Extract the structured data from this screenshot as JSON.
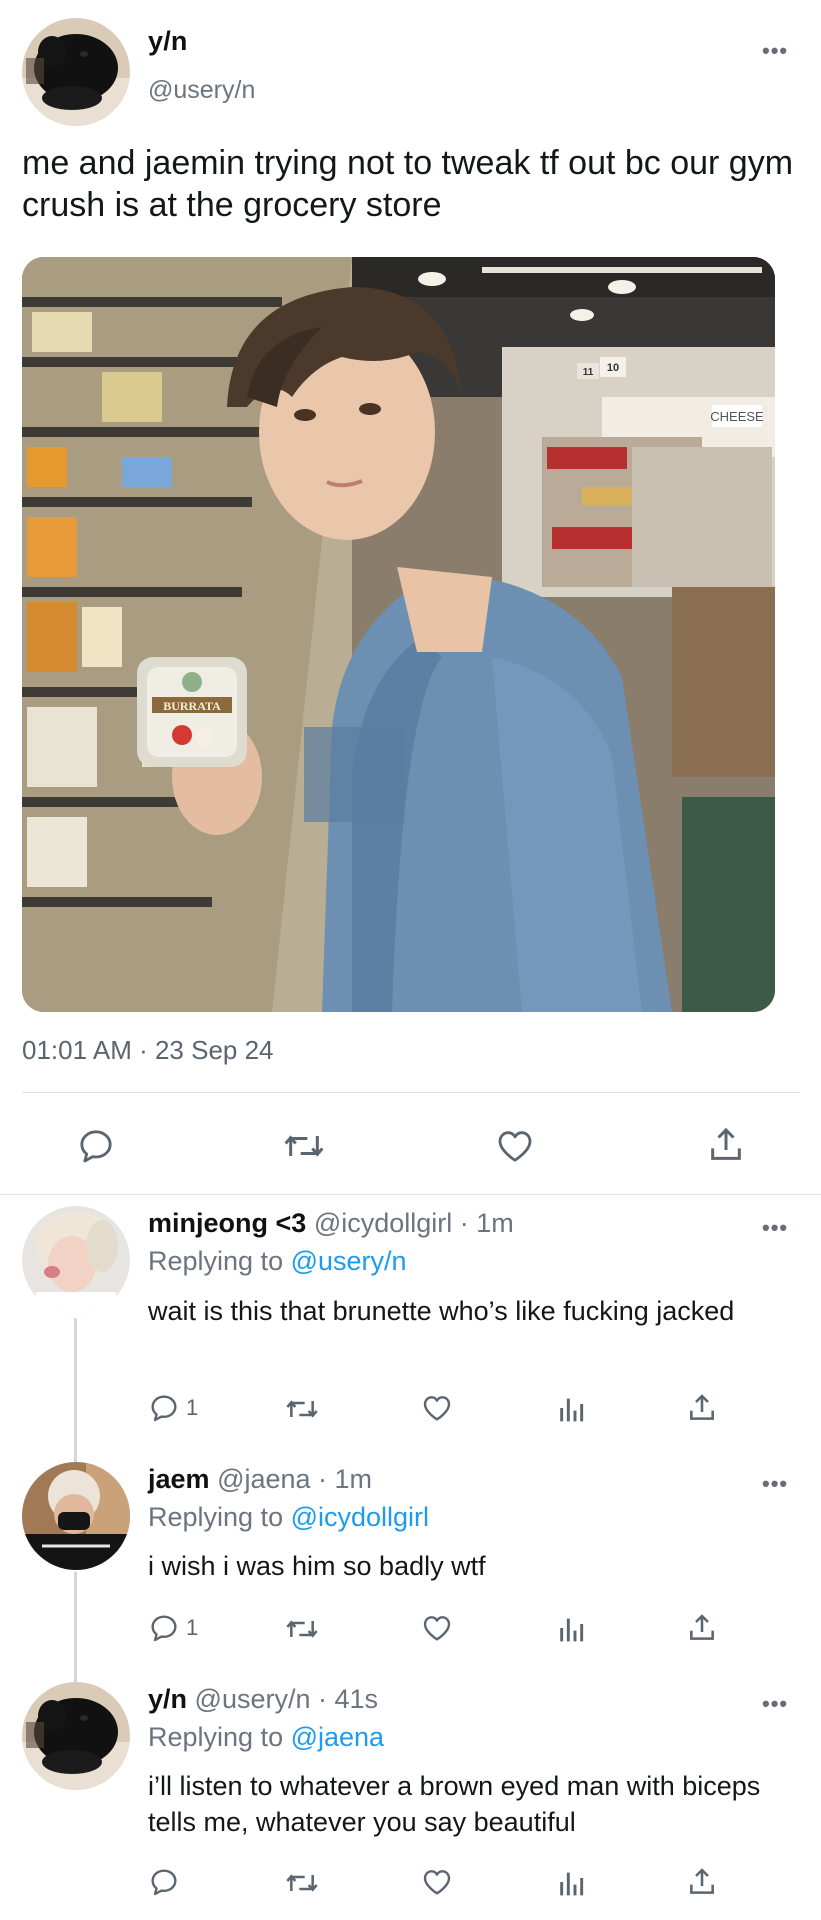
{
  "main_tweet": {
    "display_name": "y/n",
    "handle": "@usery/n",
    "text": "me and jaemin trying not to tweak tf out bc our gym crush is at the grocery store",
    "timestamp": "01:01 AM · 23 Sep 24",
    "more_icon": "ellipsis-icon",
    "photo_labels": {
      "container_label": "BURRATA",
      "store_sign": "CHEESE",
      "aisle_a": "11",
      "aisle_b": "10"
    },
    "actions": [
      "reply-icon",
      "retweet-icon",
      "like-icon",
      "share-icon"
    ]
  },
  "replies": [
    {
      "display_name": "minjeong <3",
      "handle_time": "@icydollgirl · 1m",
      "replying_prefix": "Replying to ",
      "replying_to": "@usery/n",
      "text": "wait is this that brunette who’s like fucking jacked",
      "reply_count": "1"
    },
    {
      "display_name": "jaem",
      "handle_time": "@jaena · 1m",
      "replying_prefix": "Replying to ",
      "replying_to": "@icydollgirl",
      "text": "i wish i was him so badly wtf",
      "reply_count": "1"
    },
    {
      "display_name": "y/n",
      "handle_time": "@usery/n · 41s",
      "replying_prefix": "Replying to ",
      "replying_to": "@jaena",
      "text": "i’ll listen to whatever a brown eyed man with biceps tells me, whatever you say beautiful",
      "reply_count": ""
    }
  ],
  "colors": {
    "link": "#1d9bf0",
    "secondary_text": "#6b7480",
    "icon": "#5b6570",
    "divider": "#dde3e8"
  }
}
